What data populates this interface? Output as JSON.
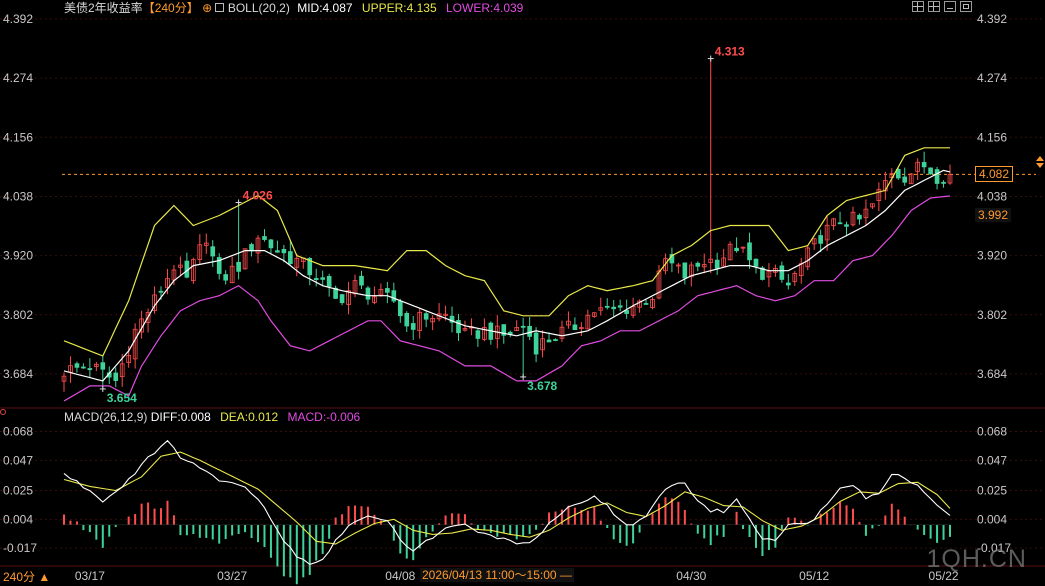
{
  "header": {
    "title": "美债2年收益率",
    "period": "【240分】",
    "boll": "BOLL(20,2)",
    "mid_label": "MID:",
    "mid": "4.087",
    "upper_label": "UPPER:",
    "upper": "4.135",
    "lower_label": "LOWER:",
    "lower": "4.039"
  },
  "macd_header": {
    "title": "MACD(26,12,9)",
    "diff_label": "DIFF:",
    "diff": "0.008",
    "dea_label": "DEA:",
    "dea": "0.012",
    "macd_label": "MACD:",
    "macd": "-0.006"
  },
  "period_select": "240分 ▲",
  "crosshair_time": "2026/04/13 11:00～15:00 —",
  "current_price": "4.082",
  "ref_price": "3.992",
  "watermark": "1QH.CN",
  "colors": {
    "up": "#ff4d4d",
    "down": "#3fd39a",
    "mid": "#ffffff",
    "upper": "#e8e84a",
    "lower": "#e04ce0",
    "diff": "#ffffff",
    "dea": "#e8e84a",
    "grid": "#3a0d0d",
    "current_line": "#ff9a2e"
  },
  "chart_data": [
    {
      "type": "candlestick",
      "title": "美债2年收益率",
      "y_ticks": [
        "4.392",
        "4.274",
        "4.156",
        "4.038",
        "3.920",
        "3.802",
        "3.684"
      ],
      "ylim": [
        3.62,
        4.392
      ],
      "x_ticks": [
        "03/17",
        "03/27",
        "04/08",
        "04/30",
        "05/12",
        "05/22"
      ],
      "x_tick_bar_index": [
        4,
        26,
        52,
        97,
        116,
        136
      ],
      "annotations": [
        {
          "label": "4.313",
          "bar_index": 100,
          "value": 4.313,
          "kind": "high"
        },
        {
          "label": "4.026",
          "bar_index": 27,
          "value": 4.026,
          "kind": "high"
        },
        {
          "label": "3.654",
          "bar_index": 6,
          "value": 3.654,
          "kind": "low"
        },
        {
          "label": "3.678",
          "bar_index": 71,
          "value": 3.678,
          "kind": "low"
        }
      ],
      "current_price_line": 4.082,
      "close_points": [
        [
          0,
          3.69
        ],
        [
          4,
          3.7
        ],
        [
          8,
          3.67
        ],
        [
          11,
          3.77
        ],
        [
          14,
          3.83
        ],
        [
          17,
          3.9
        ],
        [
          19,
          3.87
        ],
        [
          22,
          3.96
        ],
        [
          24,
          3.87
        ],
        [
          27,
          3.9
        ],
        [
          30,
          3.96
        ],
        [
          33,
          3.93
        ],
        [
          36,
          3.91
        ],
        [
          39,
          3.88
        ],
        [
          42,
          3.83
        ],
        [
          45,
          3.86
        ],
        [
          48,
          3.84
        ],
        [
          51,
          3.83
        ],
        [
          53,
          3.78
        ],
        [
          56,
          3.8
        ],
        [
          59,
          3.8
        ],
        [
          62,
          3.76
        ],
        [
          65,
          3.77
        ],
        [
          68,
          3.76
        ],
        [
          71,
          3.78
        ],
        [
          73,
          3.74
        ],
        [
          76,
          3.76
        ],
        [
          79,
          3.78
        ],
        [
          82,
          3.81
        ],
        [
          85,
          3.81
        ],
        [
          88,
          3.82
        ],
        [
          91,
          3.84
        ],
        [
          93,
          3.91
        ],
        [
          96,
          3.88
        ],
        [
          99,
          3.91
        ],
        [
          101,
          3.91
        ],
        [
          104,
          3.94
        ],
        [
          107,
          3.89
        ],
        [
          110,
          3.88
        ],
        [
          112,
          3.86
        ],
        [
          114,
          3.9
        ],
        [
          117,
          3.96
        ],
        [
          120,
          3.99
        ],
        [
          123,
          3.99
        ],
        [
          125,
          4.02
        ],
        [
          128,
          4.09
        ],
        [
          130,
          4.08
        ],
        [
          133,
          4.1
        ],
        [
          135,
          4.08
        ],
        [
          137,
          4.08
        ]
      ],
      "boll_mid_points": [
        [
          0,
          3.69
        ],
        [
          6,
          3.67
        ],
        [
          10,
          3.73
        ],
        [
          14,
          3.82
        ],
        [
          17,
          3.87
        ],
        [
          20,
          3.9
        ],
        [
          24,
          3.91
        ],
        [
          28,
          3.93
        ],
        [
          31,
          3.93
        ],
        [
          34,
          3.91
        ],
        [
          37,
          3.88
        ],
        [
          40,
          3.86
        ],
        [
          43,
          3.85
        ],
        [
          47,
          3.84
        ],
        [
          50,
          3.84
        ],
        [
          54,
          3.82
        ],
        [
          58,
          3.8
        ],
        [
          62,
          3.78
        ],
        [
          66,
          3.77
        ],
        [
          70,
          3.76
        ],
        [
          73,
          3.77
        ],
        [
          77,
          3.76
        ],
        [
          81,
          3.77
        ],
        [
          84,
          3.79
        ],
        [
          88,
          3.82
        ],
        [
          91,
          3.84
        ],
        [
          94,
          3.86
        ],
        [
          97,
          3.88
        ],
        [
          100,
          3.89
        ],
        [
          103,
          3.9
        ],
        [
          106,
          3.9
        ],
        [
          109,
          3.89
        ],
        [
          112,
          3.89
        ],
        [
          115,
          3.91
        ],
        [
          118,
          3.94
        ],
        [
          121,
          3.96
        ],
        [
          124,
          3.98
        ],
        [
          127,
          4.01
        ],
        [
          130,
          4.05
        ],
        [
          133,
          4.07
        ],
        [
          136,
          4.09
        ],
        [
          137,
          4.087
        ]
      ],
      "boll_upper_points": [
        [
          0,
          3.75
        ],
        [
          6,
          3.72
        ],
        [
          10,
          3.83
        ],
        [
          14,
          3.98
        ],
        [
          17,
          4.02
        ],
        [
          20,
          3.98
        ],
        [
          24,
          4.0
        ],
        [
          27,
          4.02
        ],
        [
          30,
          4.04
        ],
        [
          33,
          4.01
        ],
        [
          36,
          3.92
        ],
        [
          40,
          3.9
        ],
        [
          45,
          3.9
        ],
        [
          50,
          3.89
        ],
        [
          53,
          3.93
        ],
        [
          56,
          3.93
        ],
        [
          59,
          3.9
        ],
        [
          62,
          3.88
        ],
        [
          65,
          3.87
        ],
        [
          68,
          3.81
        ],
        [
          71,
          3.8
        ],
        [
          75,
          3.8
        ],
        [
          78,
          3.84
        ],
        [
          81,
          3.86
        ],
        [
          84,
          3.85
        ],
        [
          88,
          3.86
        ],
        [
          91,
          3.87
        ],
        [
          94,
          3.92
        ],
        [
          97,
          3.94
        ],
        [
          100,
          3.97
        ],
        [
          103,
          3.98
        ],
        [
          106,
          3.98
        ],
        [
          109,
          3.98
        ],
        [
          112,
          3.93
        ],
        [
          115,
          3.94
        ],
        [
          118,
          4.0
        ],
        [
          121,
          4.03
        ],
        [
          124,
          4.04
        ],
        [
          127,
          4.05
        ],
        [
          130,
          4.12
        ],
        [
          133,
          4.135
        ],
        [
          137,
          4.135
        ]
      ],
      "boll_lower_points": [
        [
          0,
          3.63
        ],
        [
          4,
          3.66
        ],
        [
          7,
          3.66
        ],
        [
          10,
          3.64
        ],
        [
          12,
          3.7
        ],
        [
          15,
          3.76
        ],
        [
          18,
          3.81
        ],
        [
          21,
          3.83
        ],
        [
          24,
          3.84
        ],
        [
          27,
          3.86
        ],
        [
          30,
          3.83
        ],
        [
          32,
          3.79
        ],
        [
          35,
          3.74
        ],
        [
          38,
          3.73
        ],
        [
          41,
          3.75
        ],
        [
          44,
          3.77
        ],
        [
          47,
          3.79
        ],
        [
          49,
          3.79
        ],
        [
          52,
          3.75
        ],
        [
          55,
          3.74
        ],
        [
          58,
          3.73
        ],
        [
          62,
          3.7
        ],
        [
          66,
          3.7
        ],
        [
          70,
          3.67
        ],
        [
          73,
          3.67
        ],
        [
          77,
          3.7
        ],
        [
          80,
          3.74
        ],
        [
          83,
          3.75
        ],
        [
          86,
          3.77
        ],
        [
          89,
          3.77
        ],
        [
          92,
          3.79
        ],
        [
          95,
          3.81
        ],
        [
          98,
          3.84
        ],
        [
          101,
          3.85
        ],
        [
          104,
          3.86
        ],
        [
          107,
          3.84
        ],
        [
          110,
          3.83
        ],
        [
          113,
          3.84
        ],
        [
          116,
          3.87
        ],
        [
          119,
          3.87
        ],
        [
          122,
          3.91
        ],
        [
          125,
          3.92
        ],
        [
          128,
          3.96
        ],
        [
          131,
          4.01
        ],
        [
          134,
          4.035
        ],
        [
          137,
          4.039
        ]
      ]
    },
    {
      "type": "macd",
      "title": "MACD(26,12,9)",
      "y_ticks": [
        "0.068",
        "0.047",
        "0.025",
        "0.004",
        "-0.017"
      ],
      "ylim": [
        -0.03,
        0.072
      ],
      "diff_points": [
        [
          0,
          0.037
        ],
        [
          3,
          0.028
        ],
        [
          6,
          0.018
        ],
        [
          8,
          0.024
        ],
        [
          11,
          0.038
        ],
        [
          13,
          0.05
        ],
        [
          16,
          0.06
        ],
        [
          18,
          0.05
        ],
        [
          20,
          0.045
        ],
        [
          23,
          0.035
        ],
        [
          26,
          0.03
        ],
        [
          28,
          0.028
        ],
        [
          30,
          0.02
        ],
        [
          32,
          0.005
        ],
        [
          34,
          -0.012
        ],
        [
          36,
          -0.022
        ],
        [
          38,
          -0.028
        ],
        [
          40,
          -0.025
        ],
        [
          42,
          -0.012
        ],
        [
          44,
          0.0
        ],
        [
          46,
          0.004
        ],
        [
          48,
          0.006
        ],
        [
          50,
          0.004
        ],
        [
          52,
          -0.01
        ],
        [
          54,
          -0.02
        ],
        [
          56,
          -0.012
        ],
        [
          58,
          -0.005
        ],
        [
          60,
          -0.002
        ],
        [
          62,
          0.0
        ],
        [
          64,
          -0.005
        ],
        [
          66,
          -0.008
        ],
        [
          68,
          -0.01
        ],
        [
          70,
          -0.015
        ],
        [
          72,
          -0.012
        ],
        [
          74,
          -0.005
        ],
        [
          76,
          0.005
        ],
        [
          78,
          0.012
        ],
        [
          80,
          0.015
        ],
        [
          82,
          0.02
        ],
        [
          84,
          0.014
        ],
        [
          86,
          0.003
        ],
        [
          88,
          0.0
        ],
        [
          90,
          0.005
        ],
        [
          92,
          0.02
        ],
        [
          94,
          0.03
        ],
        [
          96,
          0.03
        ],
        [
          98,
          0.018
        ],
        [
          100,
          0.01
        ],
        [
          102,
          0.01
        ],
        [
          104,
          0.018
        ],
        [
          106,
          0.005
        ],
        [
          108,
          -0.01
        ],
        [
          110,
          -0.01
        ],
        [
          112,
          0.0
        ],
        [
          114,
          0.0
        ],
        [
          116,
          0.005
        ],
        [
          118,
          0.015
        ],
        [
          120,
          0.028
        ],
        [
          122,
          0.03
        ],
        [
          124,
          0.02
        ],
        [
          126,
          0.022
        ],
        [
          128,
          0.038
        ],
        [
          130,
          0.034
        ],
        [
          132,
          0.03
        ],
        [
          134,
          0.018
        ],
        [
          137,
          0.008
        ]
      ],
      "dea_points": [
        [
          0,
          0.033
        ],
        [
          4,
          0.028
        ],
        [
          8,
          0.025
        ],
        [
          12,
          0.035
        ],
        [
          15,
          0.05
        ],
        [
          18,
          0.053
        ],
        [
          21,
          0.047
        ],
        [
          24,
          0.04
        ],
        [
          27,
          0.033
        ],
        [
          30,
          0.026
        ],
        [
          33,
          0.014
        ],
        [
          36,
          0.002
        ],
        [
          39,
          -0.012
        ],
        [
          42,
          -0.014
        ],
        [
          45,
          -0.006
        ],
        [
          48,
          0.001
        ],
        [
          51,
          0.004
        ],
        [
          54,
          -0.004
        ],
        [
          57,
          -0.007
        ],
        [
          60,
          -0.006
        ],
        [
          63,
          -0.003
        ],
        [
          66,
          -0.004
        ],
        [
          69,
          -0.007
        ],
        [
          72,
          -0.009
        ],
        [
          75,
          -0.004
        ],
        [
          78,
          0.005
        ],
        [
          81,
          0.012
        ],
        [
          84,
          0.016
        ],
        [
          87,
          0.009
        ],
        [
          90,
          0.006
        ],
        [
          93,
          0.014
        ],
        [
          96,
          0.024
        ],
        [
          99,
          0.02
        ],
        [
          102,
          0.014
        ],
        [
          105,
          0.013
        ],
        [
          108,
          0.003
        ],
        [
          111,
          -0.004
        ],
        [
          114,
          -0.001
        ],
        [
          117,
          0.006
        ],
        [
          120,
          0.017
        ],
        [
          123,
          0.024
        ],
        [
          126,
          0.023
        ],
        [
          129,
          0.03
        ],
        [
          132,
          0.031
        ],
        [
          135,
          0.022
        ],
        [
          137,
          0.012
        ]
      ]
    }
  ]
}
